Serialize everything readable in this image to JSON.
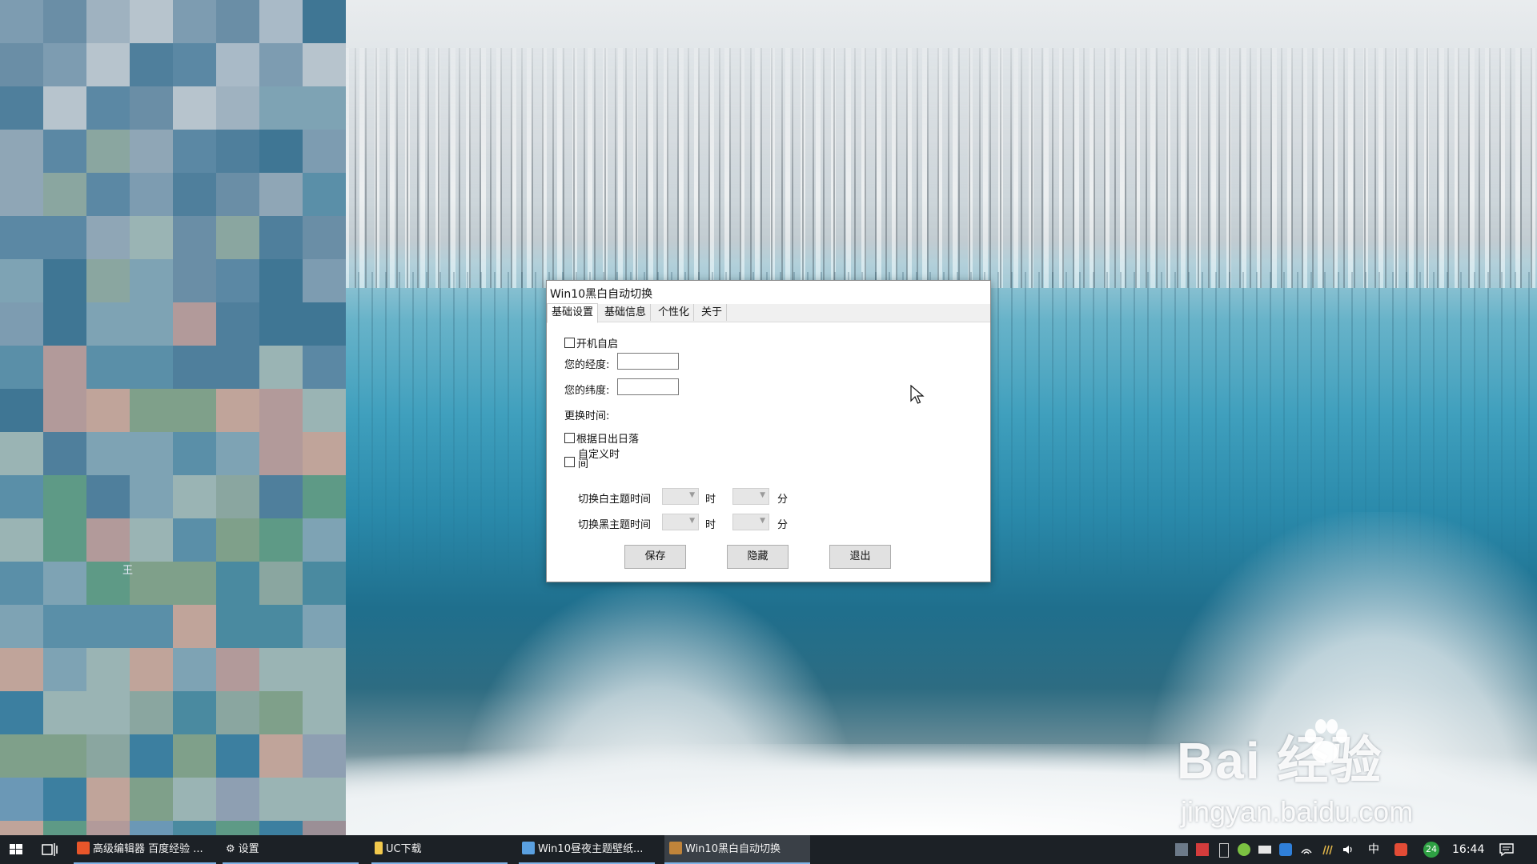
{
  "dialog": {
    "title": "Win10黑白自动切换",
    "tabs": [
      {
        "label": "基础设置",
        "active": true
      },
      {
        "label": "基础信息",
        "active": false
      },
      {
        "label": "个性化",
        "active": false
      },
      {
        "label": "关于",
        "active": false
      }
    ],
    "autostart_label": "开机自启",
    "longitude_label": "您的经度:",
    "longitude_value": "",
    "latitude_label": "您的纬度:",
    "latitude_value": "",
    "switch_time_label": "更换时间:",
    "sunrise_sunset_label": "根据日出日落",
    "custom_time_label_line1": "自定义时",
    "custom_time_label_line2": "间",
    "light_theme_time_label": "切换白主题时间",
    "dark_theme_time_label": "切换黑主题时间",
    "hour_label": "时",
    "minute_label": "分",
    "save_button": "保存",
    "hide_button": "隐藏",
    "exit_button": "退出"
  },
  "watermark": {
    "logo_text": "Bai  经验",
    "url": "jingyan.baidu.com"
  },
  "taskbar": {
    "items": [
      {
        "label": "高级编辑器 百度经验 ...",
        "icon": "browser-icon",
        "color": "#e8562a"
      },
      {
        "label": "设置",
        "icon": "gear-icon",
        "color": "#cccccc"
      },
      {
        "label": "UC下载",
        "icon": "folder-icon",
        "color": "#f2c94c"
      },
      {
        "label": "Win10昼夜主题壁纸...",
        "icon": "folder-icon",
        "color": "#5aa0e0"
      },
      {
        "label": "Win10黑白自动切换",
        "icon": "app-icon",
        "color": "#c0843a"
      }
    ],
    "tray": {
      "badge_count": "24",
      "ime": "中",
      "time": "16:44"
    }
  },
  "colors": {
    "taskbar_bg": "#1c2126",
    "dialog_bg": "#ffffff",
    "tab_strip_bg": "#f0f0f0",
    "button_bg": "#e1e1e1"
  }
}
